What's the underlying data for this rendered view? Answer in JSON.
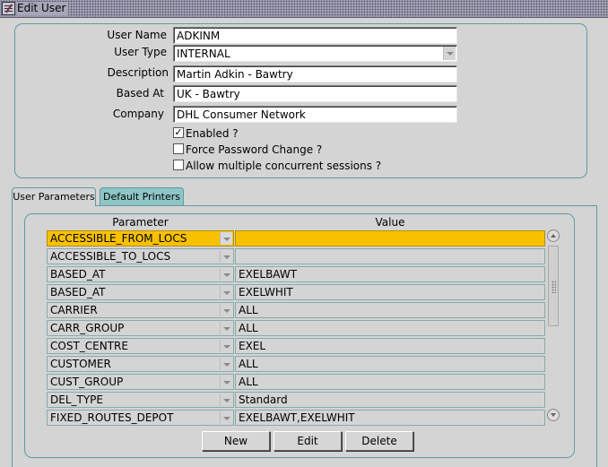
{
  "window": {
    "title": "Edit User"
  },
  "user": {
    "user_name_label": "User Name",
    "user_name": "ADKINM",
    "user_type_label": "User Type",
    "user_type": "INTERNAL",
    "description_label": "Description",
    "description": "Martin Adkin - Bawtry",
    "based_at_label": "Based At",
    "based_at": "UK - Bawtry",
    "company_label": "Company",
    "company": "DHL Consumer Network",
    "enabled_label": "Enabled ?",
    "enabled": true,
    "force_password_label": "Force Password Change ?",
    "force_password": false,
    "multi_sessions_label": "Allow multiple concurrent sessions ?",
    "multi_sessions": false
  },
  "tabs": [
    {
      "label": "User Parameters",
      "active": true
    },
    {
      "label": "Default Printers",
      "active": false
    }
  ],
  "params": {
    "col_parameter": "Parameter",
    "col_value": "Value",
    "rows": [
      {
        "parameter": "ACCESSIBLE_FROM_LOCS",
        "value": "",
        "selected": true
      },
      {
        "parameter": "ACCESSIBLE_TO_LOCS",
        "value": ""
      },
      {
        "parameter": "BASED_AT",
        "value": "EXELBAWT"
      },
      {
        "parameter": "BASED_AT",
        "value": "EXELWHIT"
      },
      {
        "parameter": "CARRIER",
        "value": "ALL"
      },
      {
        "parameter": "CARR_GROUP",
        "value": "ALL"
      },
      {
        "parameter": "COST_CENTRE",
        "value": "EXEL"
      },
      {
        "parameter": "CUSTOMER",
        "value": "ALL"
      },
      {
        "parameter": "CUST_GROUP",
        "value": "ALL"
      },
      {
        "parameter": "DEL_TYPE",
        "value": "Standard"
      },
      {
        "parameter": "FIXED_ROUTES_DEPOT",
        "value": "EXELBAWT,EXELWHIT"
      }
    ]
  },
  "buttons": {
    "new": "New",
    "edit": "Edit",
    "delete": "Delete"
  },
  "colors": {
    "selected_row": "#f7c100",
    "panel_border": "#5f9aa3",
    "inactive_tab": "#8ec5c5"
  }
}
